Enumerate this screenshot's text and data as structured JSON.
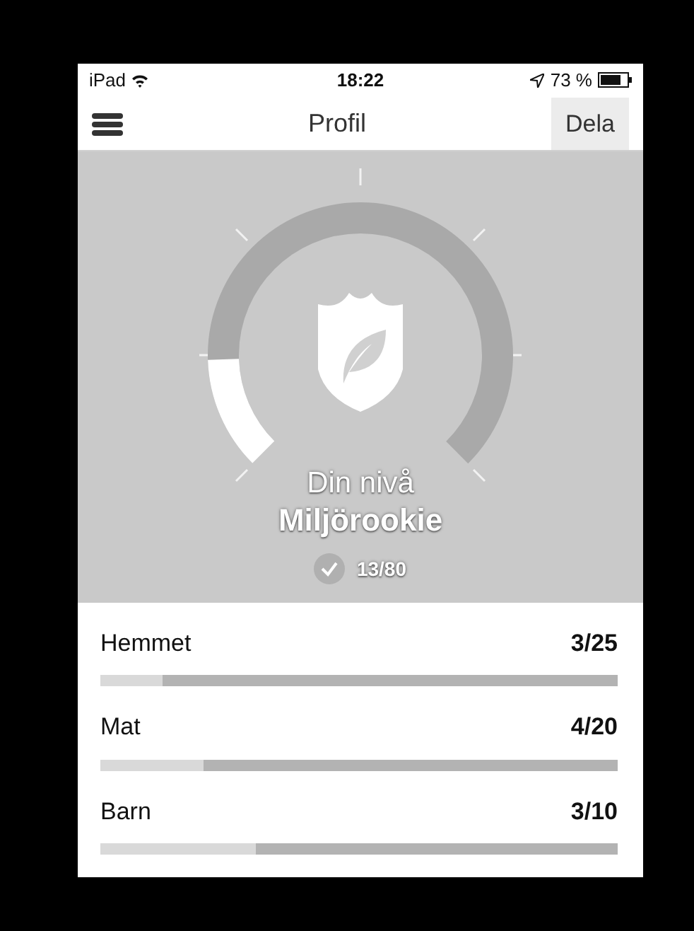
{
  "status_bar": {
    "device": "iPad",
    "time": "18:22",
    "battery": "73 %"
  },
  "nav": {
    "title": "Profil",
    "share_button": "Dela"
  },
  "level": {
    "caption": "Din nivå",
    "name": "Miljörookie",
    "score": "13/80",
    "level": 0.16
  },
  "categories": [
    {
      "name": "Hemmet",
      "score": "3/25",
      "level": 0.12
    },
    {
      "name": "Mat",
      "score": "4/20",
      "level": 0.2
    },
    {
      "name": "Barn",
      "score": "3/10",
      "level": 0.3
    }
  ]
}
